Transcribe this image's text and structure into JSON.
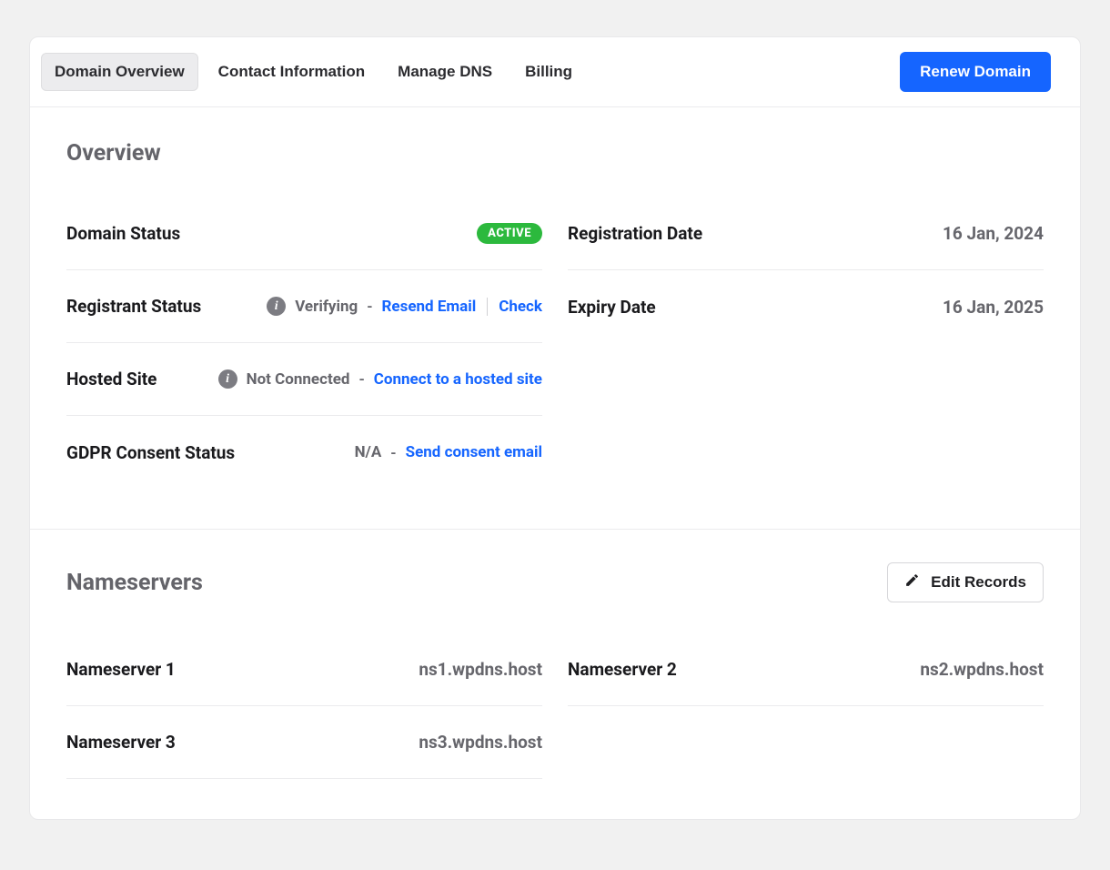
{
  "tabs": {
    "items": [
      {
        "label": "Domain Overview",
        "active": true
      },
      {
        "label": "Contact Information",
        "active": false
      },
      {
        "label": "Manage DNS",
        "active": false
      },
      {
        "label": "Billing",
        "active": false
      }
    ],
    "renew_label": "Renew Domain"
  },
  "overview": {
    "title": "Overview",
    "domain_status": {
      "label": "Domain Status",
      "badge": "ACTIVE"
    },
    "registration_date": {
      "label": "Registration Date",
      "value": "16 Jan, 2024"
    },
    "registrant_status": {
      "label": "Registrant Status",
      "status": "Verifying",
      "resend": "Resend Email",
      "check": "Check"
    },
    "expiry_date": {
      "label": "Expiry Date",
      "value": "16 Jan, 2025"
    },
    "hosted_site": {
      "label": "Hosted Site",
      "status": "Not Connected",
      "connect": "Connect to a hosted site"
    },
    "gdpr": {
      "label": "GDPR Consent Status",
      "value": "N/A",
      "action": "Send consent email"
    }
  },
  "nameservers": {
    "title": "Nameservers",
    "edit_label": "Edit Records",
    "items": [
      {
        "label": "Nameserver 1",
        "value": "ns1.wpdns.host"
      },
      {
        "label": "Nameserver 2",
        "value": "ns2.wpdns.host"
      },
      {
        "label": "Nameserver 3",
        "value": "ns3.wpdns.host"
      }
    ]
  }
}
